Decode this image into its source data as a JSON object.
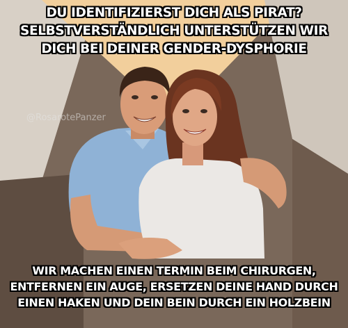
{
  "meme": {
    "top_caption": [
      "DU IDENTIFIZIERST DICH ALS PIRAT?",
      "SELBSTVERSTÄNDLICH UNTERSTÜTZEN WIR",
      "DICH BEI DEINER GENDER-DYSPHORIE"
    ],
    "bottom_caption": [
      "WIR MACHEN EINEN TERMIN BEIM CHIRURGEN,",
      "ENTFERNEN EIN AUGE, ERSETZEN DEINE HAND DURCH",
      "EINEN HAKEN UND DEIN BEIN DURCH EIN HOLZBEIN"
    ],
    "watermark": "@RosarotePanzer"
  },
  "colors": {
    "background_peach": "#f3d3a4",
    "background_brown": "#7a685a",
    "background_dark": "#5c4c40",
    "background_light": "#d9d0c4",
    "shirt_blue": "#8fb3d7",
    "sweater_white": "#ece9e6",
    "hair_dark": "#3a2418",
    "hair_auburn": "#6a3420",
    "skin": "#d99c78"
  }
}
